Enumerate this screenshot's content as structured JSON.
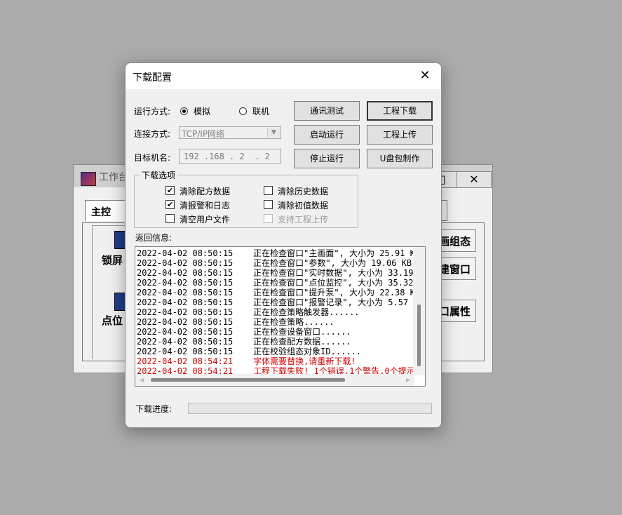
{
  "background_window": {
    "title": "工作台",
    "tab_label": "主控",
    "min_glyph": "□",
    "close_glyph": "✕",
    "items": [
      {
        "label": "锁屏"
      },
      {
        "label": "点位"
      }
    ],
    "right_buttons": [
      {
        "label": "画组态"
      },
      {
        "label": "建窗口"
      },
      {
        "label": "口属性"
      }
    ]
  },
  "dialog": {
    "title": "下载配置",
    "close_glyph": "✕",
    "run_mode": {
      "label": "运行方式:",
      "options": [
        {
          "label": "模拟",
          "selected": true
        },
        {
          "label": "联机",
          "selected": false
        }
      ]
    },
    "connect_mode": {
      "label": "连接方式:",
      "value": "TCP/IP网络",
      "arrow": "▼"
    },
    "target": {
      "label": "目标机名:",
      "value": "192 .168 . 2  . 2"
    },
    "buttons": {
      "comm_test": "通讯测试",
      "project_download": "工程下载",
      "start_run": "启动运行",
      "project_upload": "工程上传",
      "stop_run": "停止运行",
      "usb_make": "U盘包制作"
    },
    "download_options": {
      "title": "下载选项",
      "checkboxes": [
        {
          "label": "清除配方数据",
          "checked": true,
          "enabled": true
        },
        {
          "label": "清除历史数据",
          "checked": false,
          "enabled": true
        },
        {
          "label": "清报警和日志",
          "checked": true,
          "enabled": true
        },
        {
          "label": "清除初值数据",
          "checked": false,
          "enabled": true
        },
        {
          "label": "清空用户文件",
          "checked": false,
          "enabled": true
        },
        {
          "label": "支持工程上传",
          "checked": false,
          "enabled": false
        }
      ],
      "check_glyph": "✔"
    },
    "return_info": {
      "label": "返回信息:",
      "lines": [
        {
          "text": "2022-04-02 08:50:15    正在检查窗口\"主画面\", 大小为 25.91 K",
          "error": false
        },
        {
          "text": "2022-04-02 08:50:15    正在检查窗口\"参数\", 大小为 19.06 KB",
          "error": false
        },
        {
          "text": "2022-04-02 08:50:15    正在检查窗口\"实时数据\", 大小为 33.19",
          "error": false
        },
        {
          "text": "2022-04-02 08:50:15    正在检查窗口\"点位监控\", 大小为 35.32",
          "error": false
        },
        {
          "text": "2022-04-02 08:50:15    正在检查窗口\"提升泵\", 大小为 22.38 K",
          "error": false
        },
        {
          "text": "2022-04-02 08:50:15    正在检查窗口\"报警记录\", 大小为 5.57",
          "error": false
        },
        {
          "text": "2022-04-02 08:50:15    正在检查策略触发器......",
          "error": false
        },
        {
          "text": "2022-04-02 08:50:15    正在检查策略......",
          "error": false
        },
        {
          "text": "2022-04-02 08:50:15    正在检查设备窗口......",
          "error": false
        },
        {
          "text": "2022-04-02 08:50:15    正在检查配方数据......",
          "error": false
        },
        {
          "text": "2022-04-02 08:50:15    正在校验组态对象ID......",
          "error": false
        },
        {
          "text": "2022-04-02 08:54:21    字体需要替换,请重新下载!",
          "error": true
        },
        {
          "text": "2022-04-02 08:54:21    工程下载失败! 1个错误,1个警告,0个提示",
          "error": true
        }
      ],
      "error_color": "#d00000"
    },
    "progress": {
      "label": "下载进度:",
      "value": 0
    }
  }
}
